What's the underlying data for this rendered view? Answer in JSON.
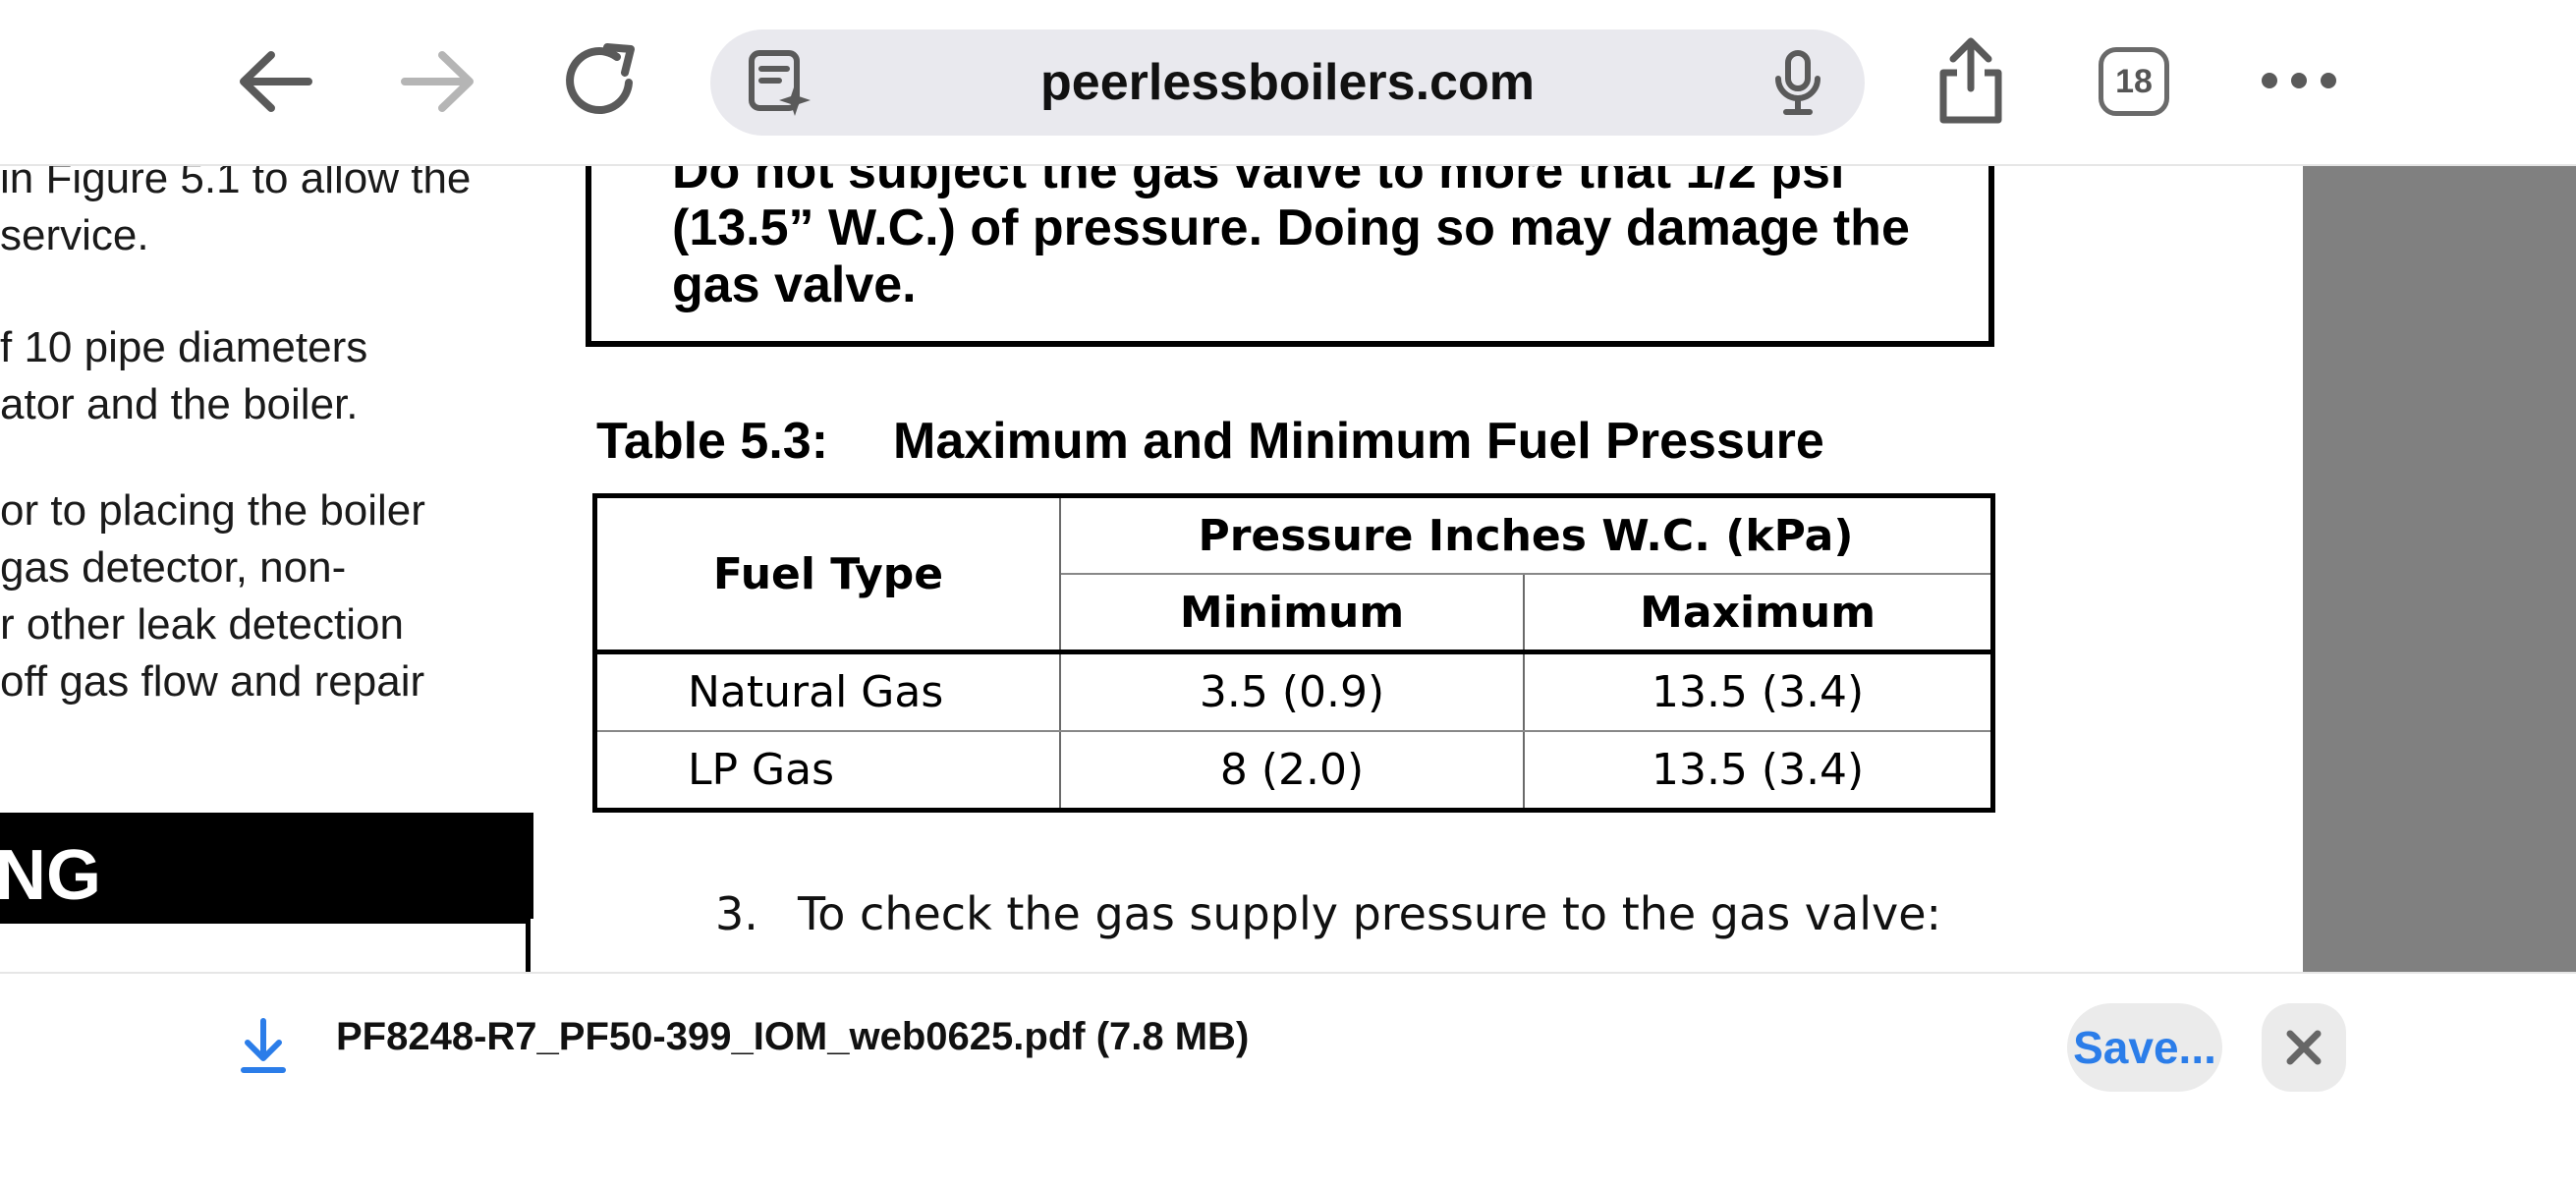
{
  "browser": {
    "url": "peerlessboilers.com",
    "tab_count": "18",
    "icons": [
      "back-icon",
      "forward-icon",
      "reload-icon",
      "reader-icon",
      "microphone-icon",
      "share-icon",
      "tabs-icon",
      "more-icon"
    ]
  },
  "document": {
    "left_column": {
      "lines": [
        "in Figure 5.1 to allow the",
        " service.",
        "f 10 pipe diameters",
        "ator and the boiler.",
        "or to placing the boiler",
        "gas detector, non-",
        "r other leak detection",
        " off gas flow and repair"
      ],
      "warning_fragment": "NG"
    },
    "caution": {
      "lines": [
        "Do not subject the gas valve to more that 1/2 psi",
        "(13.5” W.C.) of pressure. Doing so may damage the",
        "gas valve."
      ]
    },
    "table": {
      "number": "Table 5.3:",
      "title": "Maximum and Minimum Fuel Pressure",
      "headers": {
        "fuel_type": "Fuel Type",
        "pressure_group": "Pressure Inches W.C. (kPa)",
        "minimum": "Minimum",
        "maximum": "Maximum"
      },
      "rows": [
        {
          "fuel": "Natural Gas",
          "minimum": "3.5 (0.9)",
          "maximum": "13.5 (3.4)"
        },
        {
          "fuel": "LP Gas",
          "minimum": "8 (2.0)",
          "maximum": "13.5 (3.4)"
        }
      ]
    },
    "step": {
      "number": "3.",
      "text": "To check the gas supply pressure to the gas valve:"
    }
  },
  "download": {
    "filename": "PF8248-R7_PF50-399_IOM_web0625.pdf (7.8 MB)",
    "save_label": "Save...",
    "accent_color": "#2b7de9"
  }
}
